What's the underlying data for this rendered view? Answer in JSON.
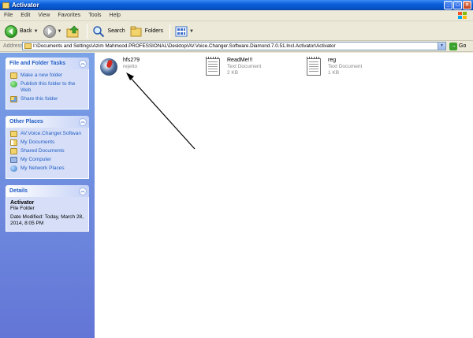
{
  "window": {
    "title": "Activator"
  },
  "menu": [
    "File",
    "Edit",
    "View",
    "Favorites",
    "Tools",
    "Help"
  ],
  "toolbar": {
    "back_label": "Back",
    "search_label": "Search",
    "folders_label": "Folders"
  },
  "address": {
    "label": "Address",
    "path": "I:\\Documents and Settings\\Azim Mahmood.PROFESSIONAL\\Desktop\\AV.Voice.Changer.Software.Diamond.7.0.51.Incl.Activator\\Activator",
    "go_label": "Go"
  },
  "tasks": {
    "title": "File and Folder Tasks",
    "items": [
      "Make a new folder",
      "Publish this folder to the Web",
      "Share this folder"
    ]
  },
  "other_places": {
    "title": "Other Places",
    "items": [
      "AV.Voice.Changer.Softwan",
      "My Documents",
      "Shared Documents",
      "My Computer",
      "My Network Places"
    ]
  },
  "details": {
    "title": "Details",
    "name": "Activator",
    "type": "File Folder",
    "date": "Date Modified: Today, March 28, 2014, 8:05 PM"
  },
  "files": [
    {
      "name": "hfs279",
      "sub1": "rejetto",
      "sub2": "",
      "icon": "hfs-icon"
    },
    {
      "name": "ReadMe!!!",
      "sub1": "Text Document",
      "sub2": "2 KB",
      "icon": "text-document-icon"
    },
    {
      "name": "reg",
      "sub1": "Text Document",
      "sub2": "1 KB",
      "icon": "text-document-icon"
    }
  ]
}
